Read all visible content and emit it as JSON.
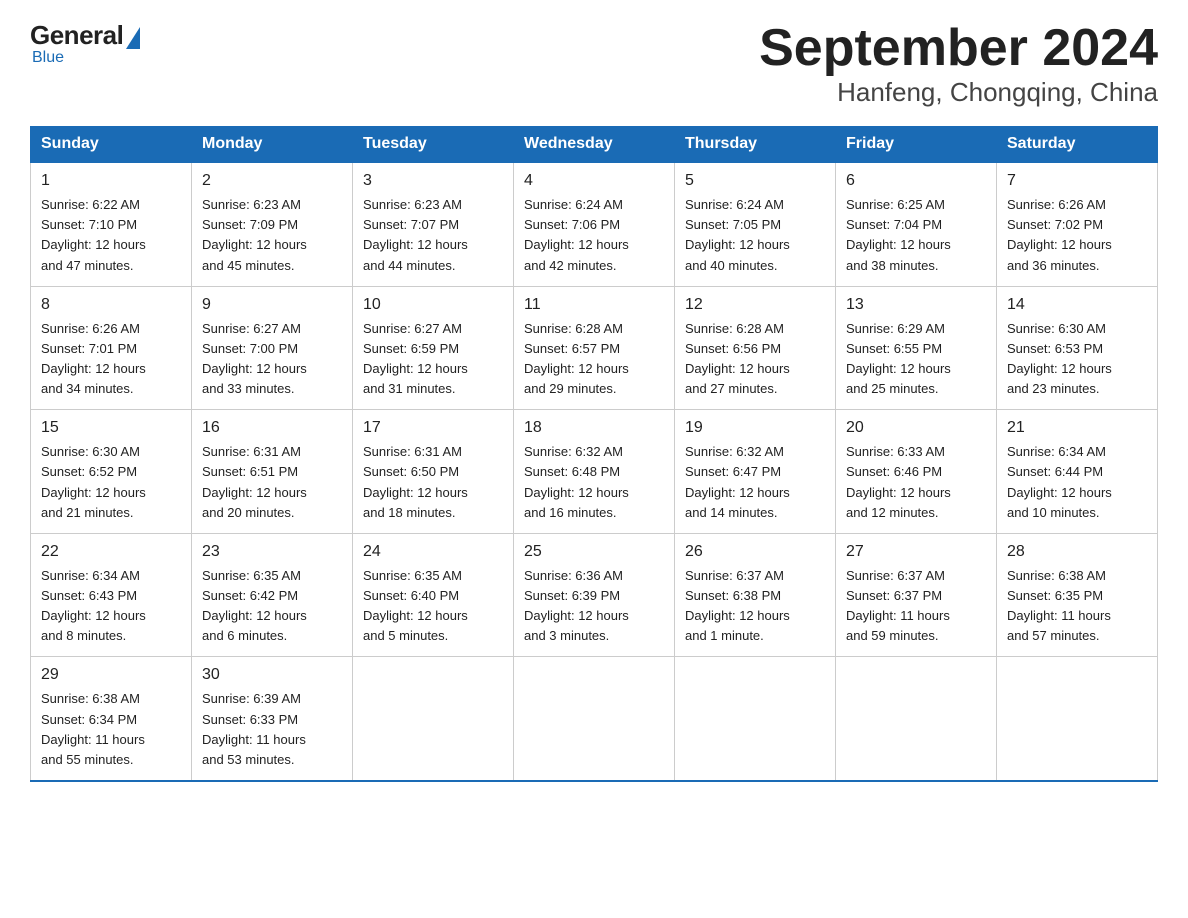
{
  "logo": {
    "general": "General",
    "blue": "Blue",
    "subtitle": "Blue"
  },
  "title": "September 2024",
  "subtitle": "Hanfeng, Chongqing, China",
  "headers": [
    "Sunday",
    "Monday",
    "Tuesday",
    "Wednesday",
    "Thursday",
    "Friday",
    "Saturday"
  ],
  "weeks": [
    [
      {
        "day": "1",
        "sunrise": "6:22 AM",
        "sunset": "7:10 PM",
        "daylight": "12 hours and 47 minutes."
      },
      {
        "day": "2",
        "sunrise": "6:23 AM",
        "sunset": "7:09 PM",
        "daylight": "12 hours and 45 minutes."
      },
      {
        "day": "3",
        "sunrise": "6:23 AM",
        "sunset": "7:07 PM",
        "daylight": "12 hours and 44 minutes."
      },
      {
        "day": "4",
        "sunrise": "6:24 AM",
        "sunset": "7:06 PM",
        "daylight": "12 hours and 42 minutes."
      },
      {
        "day": "5",
        "sunrise": "6:24 AM",
        "sunset": "7:05 PM",
        "daylight": "12 hours and 40 minutes."
      },
      {
        "day": "6",
        "sunrise": "6:25 AM",
        "sunset": "7:04 PM",
        "daylight": "12 hours and 38 minutes."
      },
      {
        "day": "7",
        "sunrise": "6:26 AM",
        "sunset": "7:02 PM",
        "daylight": "12 hours and 36 minutes."
      }
    ],
    [
      {
        "day": "8",
        "sunrise": "6:26 AM",
        "sunset": "7:01 PM",
        "daylight": "12 hours and 34 minutes."
      },
      {
        "day": "9",
        "sunrise": "6:27 AM",
        "sunset": "7:00 PM",
        "daylight": "12 hours and 33 minutes."
      },
      {
        "day": "10",
        "sunrise": "6:27 AM",
        "sunset": "6:59 PM",
        "daylight": "12 hours and 31 minutes."
      },
      {
        "day": "11",
        "sunrise": "6:28 AM",
        "sunset": "6:57 PM",
        "daylight": "12 hours and 29 minutes."
      },
      {
        "day": "12",
        "sunrise": "6:28 AM",
        "sunset": "6:56 PM",
        "daylight": "12 hours and 27 minutes."
      },
      {
        "day": "13",
        "sunrise": "6:29 AM",
        "sunset": "6:55 PM",
        "daylight": "12 hours and 25 minutes."
      },
      {
        "day": "14",
        "sunrise": "6:30 AM",
        "sunset": "6:53 PM",
        "daylight": "12 hours and 23 minutes."
      }
    ],
    [
      {
        "day": "15",
        "sunrise": "6:30 AM",
        "sunset": "6:52 PM",
        "daylight": "12 hours and 21 minutes."
      },
      {
        "day": "16",
        "sunrise": "6:31 AM",
        "sunset": "6:51 PM",
        "daylight": "12 hours and 20 minutes."
      },
      {
        "day": "17",
        "sunrise": "6:31 AM",
        "sunset": "6:50 PM",
        "daylight": "12 hours and 18 minutes."
      },
      {
        "day": "18",
        "sunrise": "6:32 AM",
        "sunset": "6:48 PM",
        "daylight": "12 hours and 16 minutes."
      },
      {
        "day": "19",
        "sunrise": "6:32 AM",
        "sunset": "6:47 PM",
        "daylight": "12 hours and 14 minutes."
      },
      {
        "day": "20",
        "sunrise": "6:33 AM",
        "sunset": "6:46 PM",
        "daylight": "12 hours and 12 minutes."
      },
      {
        "day": "21",
        "sunrise": "6:34 AM",
        "sunset": "6:44 PM",
        "daylight": "12 hours and 10 minutes."
      }
    ],
    [
      {
        "day": "22",
        "sunrise": "6:34 AM",
        "sunset": "6:43 PM",
        "daylight": "12 hours and 8 minutes."
      },
      {
        "day": "23",
        "sunrise": "6:35 AM",
        "sunset": "6:42 PM",
        "daylight": "12 hours and 6 minutes."
      },
      {
        "day": "24",
        "sunrise": "6:35 AM",
        "sunset": "6:40 PM",
        "daylight": "12 hours and 5 minutes."
      },
      {
        "day": "25",
        "sunrise": "6:36 AM",
        "sunset": "6:39 PM",
        "daylight": "12 hours and 3 minutes."
      },
      {
        "day": "26",
        "sunrise": "6:37 AM",
        "sunset": "6:38 PM",
        "daylight": "12 hours and 1 minute."
      },
      {
        "day": "27",
        "sunrise": "6:37 AM",
        "sunset": "6:37 PM",
        "daylight": "11 hours and 59 minutes."
      },
      {
        "day": "28",
        "sunrise": "6:38 AM",
        "sunset": "6:35 PM",
        "daylight": "11 hours and 57 minutes."
      }
    ],
    [
      {
        "day": "29",
        "sunrise": "6:38 AM",
        "sunset": "6:34 PM",
        "daylight": "11 hours and 55 minutes."
      },
      {
        "day": "30",
        "sunrise": "6:39 AM",
        "sunset": "6:33 PM",
        "daylight": "11 hours and 53 minutes."
      },
      {
        "day": "",
        "sunrise": "",
        "sunset": "",
        "daylight": ""
      },
      {
        "day": "",
        "sunrise": "",
        "sunset": "",
        "daylight": ""
      },
      {
        "day": "",
        "sunrise": "",
        "sunset": "",
        "daylight": ""
      },
      {
        "day": "",
        "sunrise": "",
        "sunset": "",
        "daylight": ""
      },
      {
        "day": "",
        "sunrise": "",
        "sunset": "",
        "daylight": ""
      }
    ]
  ],
  "sunrise_label": "Sunrise:",
  "sunset_label": "Sunset:",
  "daylight_label": "Daylight:"
}
